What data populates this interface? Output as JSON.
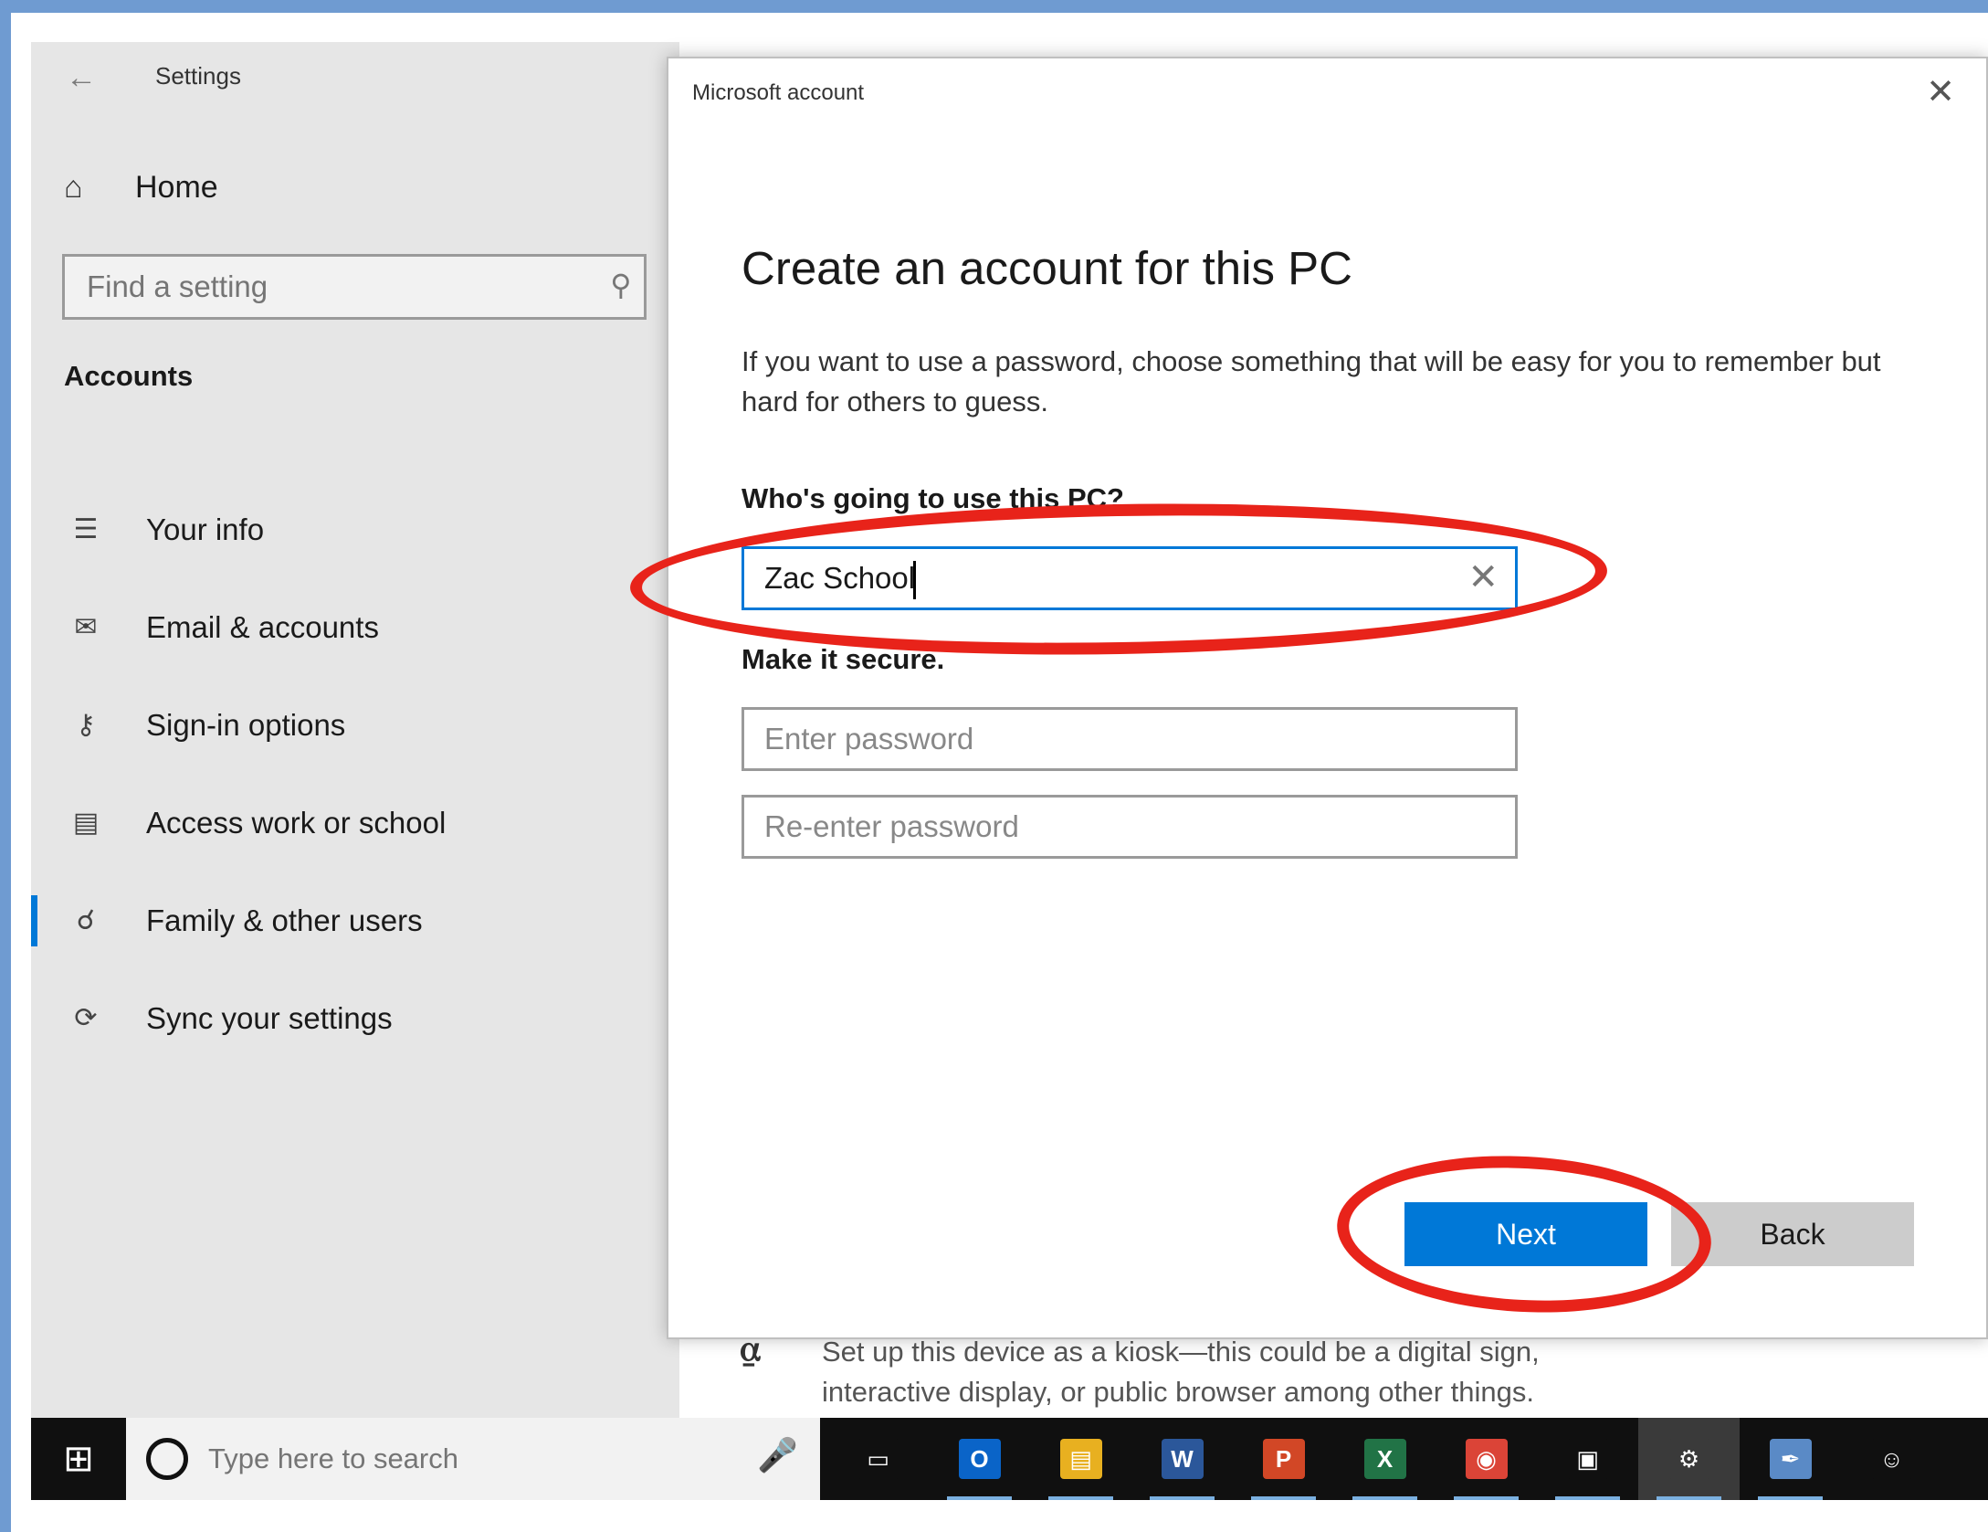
{
  "settings": {
    "title": "Settings",
    "home": "Home",
    "search_placeholder": "Find a setting",
    "section": "Accounts",
    "nav": [
      {
        "label": "Your info",
        "icon": "person-list-icon"
      },
      {
        "label": "Email & accounts",
        "icon": "mail-icon"
      },
      {
        "label": "Sign-in options",
        "icon": "key-icon"
      },
      {
        "label": "Access work or school",
        "icon": "briefcase-icon"
      },
      {
        "label": "Family & other users",
        "icon": "person-add-icon",
        "active": true
      },
      {
        "label": "Sync your settings",
        "icon": "sync-icon"
      }
    ]
  },
  "background": {
    "kiosk_line1": "Set up this device as a kiosk—this could be a digital sign,",
    "kiosk_line2": "interactive display, or public browser among other things."
  },
  "dialog": {
    "caption": "Microsoft account",
    "heading": "Create an account for this PC",
    "description": "If you want to use a password, choose something that will be easy for you to remember but hard for others to guess.",
    "who_label": "Who's going to use this PC?",
    "name_value": "Zac School",
    "secure_label": "Make it secure.",
    "password_placeholder": "Enter password",
    "reenter_placeholder": "Re-enter password",
    "next_label": "Next",
    "back_label": "Back"
  },
  "taskbar": {
    "search_placeholder": "Type here to search",
    "apps": [
      {
        "name": "task-view-icon",
        "text": "▭",
        "color": "#101010"
      },
      {
        "name": "outlook-icon",
        "text": "O",
        "color": "#0a64c8"
      },
      {
        "name": "file-explorer-icon",
        "text": "▤",
        "color": "#e8b020"
      },
      {
        "name": "word-icon",
        "text": "W",
        "color": "#2b579a"
      },
      {
        "name": "powerpoint-icon",
        "text": "P",
        "color": "#d24726"
      },
      {
        "name": "excel-icon",
        "text": "X",
        "color": "#217346"
      },
      {
        "name": "chrome-icon",
        "text": "◉",
        "color": "#db4437"
      },
      {
        "name": "remote-desktop-icon",
        "text": "▣",
        "color": "#101010"
      },
      {
        "name": "settings-gear-icon",
        "text": "⚙",
        "color": "#3a3a3a"
      },
      {
        "name": "paint-icon",
        "text": "✒",
        "color": "#5a8ac6"
      },
      {
        "name": "people-icon",
        "text": "☺",
        "color": "#101010"
      }
    ]
  },
  "colors": {
    "accent": "#0078d7",
    "annotation": "#e8231a"
  }
}
